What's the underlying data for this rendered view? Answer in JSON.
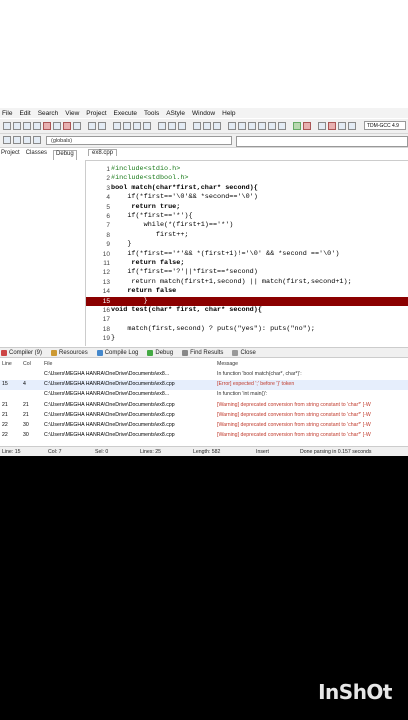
{
  "menu": [
    "File",
    "Edit",
    "Search",
    "View",
    "Project",
    "Execute",
    "Tools",
    "AStyle",
    "Window",
    "Help"
  ],
  "toolbar": {
    "compiler": "TDM-GCC 4.9"
  },
  "toolbar2": {
    "scope": "(globals)"
  },
  "left_tabs": [
    "Project",
    "Classes",
    "Debug"
  ],
  "file_tab": "ex8.cpp",
  "code": [
    {
      "n": "1",
      "t": "#include<stdio.h>",
      "cls": "pp"
    },
    {
      "n": "2",
      "t": "#include<stdbool.h>",
      "cls": "pp"
    },
    {
      "n": "3",
      "t": "bool match(char*first,char* second){",
      "cls": "kw"
    },
    {
      "n": "4",
      "t": "    if(*first=='\\0'&& *second=='\\0')",
      "cls": ""
    },
    {
      "n": "5",
      "t": "     return true;",
      "cls": "kw"
    },
    {
      "n": "6",
      "t": "    if(*first=='*'){",
      "cls": ""
    },
    {
      "n": "7",
      "t": "        while(*(first+1)=='*')",
      "cls": ""
    },
    {
      "n": "8",
      "t": "           first++;",
      "cls": ""
    },
    {
      "n": "9",
      "t": "    }",
      "cls": ""
    },
    {
      "n": "10",
      "t": "    if(*first=='*'&& *(first+1)!='\\0' && *second =='\\0')",
      "cls": ""
    },
    {
      "n": "11",
      "t": "     return false;",
      "cls": "kw"
    },
    {
      "n": "12",
      "t": "    if(*first=='?'||*first==*second)",
      "cls": ""
    },
    {
      "n": "13",
      "t": "     return match(first+1,second) || match(first,second+1);",
      "cls": ""
    },
    {
      "n": "14",
      "t": "    return false",
      "cls": "kw"
    },
    {
      "n": "15",
      "t": "        }",
      "cls": "hl"
    },
    {
      "n": "16",
      "t": "void test(char* first, char* second){",
      "cls": "kw"
    },
    {
      "n": "17",
      "t": "",
      "cls": ""
    },
    {
      "n": "18",
      "t": "    match(first,second) ? puts(\"yes\"): puts(\"no\");",
      "cls": ""
    },
    {
      "n": "19",
      "t": "}",
      "cls": ""
    }
  ],
  "bottom_tabs": [
    "Compiler (9)",
    "Resources",
    "Compile Log",
    "Debug",
    "Find Results",
    "Close"
  ],
  "messages": {
    "headers": {
      "line": "Line",
      "col": "Col",
      "file": "File",
      "message": "Message"
    },
    "rows": [
      {
        "line": "",
        "col": "",
        "file": "C:\\Users\\MEGHA HANRA\\OneDrive\\Documents\\ex8...",
        "message": "In function 'bool match(char*, char*)':",
        "kind": "head"
      },
      {
        "line": "15",
        "col": "4",
        "file": "C:\\Users\\MEGHA HANRA\\OneDrive\\Documents\\ex8.cpp",
        "message": "[Error] expected ';' before '}' token",
        "kind": "err"
      },
      {
        "line": "",
        "col": "",
        "file": "C:\\Users\\MEGHA HANRA\\OneDrive\\Documents\\ex8...",
        "message": "In function 'int main()':",
        "kind": "head"
      },
      {
        "line": "21",
        "col": "21",
        "file": "C:\\Users\\MEGHA HANRA\\OneDrive\\Documents\\ex8.cpp",
        "message": "[Warning] deprecated conversion from string constant to 'char*' [-W",
        "kind": "warn"
      },
      {
        "line": "21",
        "col": "21",
        "file": "C:\\Users\\MEGHA HANRA\\OneDrive\\Documents\\ex8.cpp",
        "message": "[Warning] deprecated conversion from string constant to 'char*' [-W",
        "kind": "warn"
      },
      {
        "line": "22",
        "col": "30",
        "file": "C:\\Users\\MEGHA HANRA\\OneDrive\\Documents\\ex8.cpp",
        "message": "[Warning] deprecated conversion from string constant to 'char*' [-W",
        "kind": "warn"
      },
      {
        "line": "22",
        "col": "30",
        "file": "C:\\Users\\MEGHA HANRA\\OneDrive\\Documents\\ex8.cpp",
        "message": "[Warning] deprecated conversion from string constant to 'char*' [-W",
        "kind": "warn"
      }
    ]
  },
  "status": {
    "line": "Line:    15",
    "col": "Col:    7",
    "sel": "Sel:    0",
    "lines": "Lines:    25",
    "length": "Length:    582",
    "mode": "Insert",
    "parse": "Done parsing in 0.157 seconds"
  },
  "watermark": "InShOt"
}
